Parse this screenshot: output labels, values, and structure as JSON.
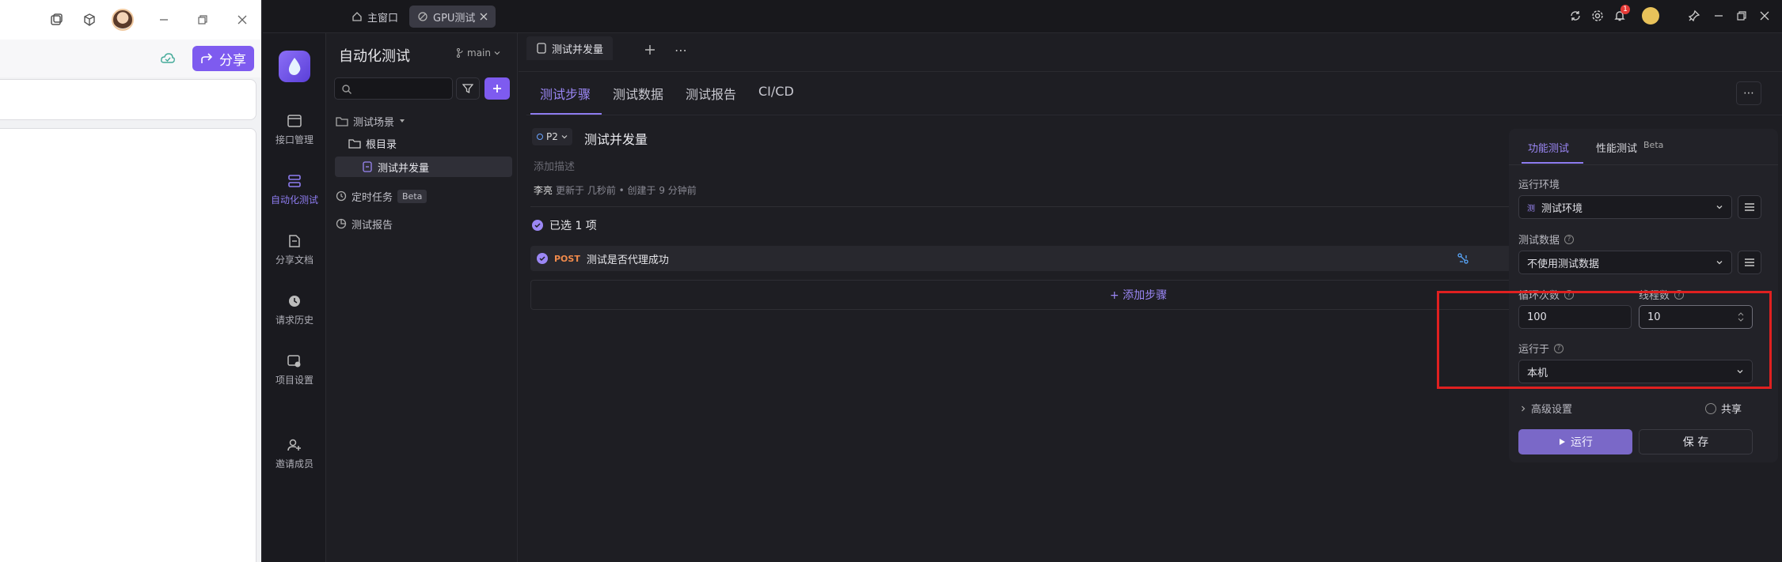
{
  "browser": {
    "share_label": "分享"
  },
  "topbar": {
    "home_tab": "主窗口",
    "active_tab": "GPU测试",
    "notification_count": "1"
  },
  "nav": {
    "items": [
      {
        "label": "接口管理"
      },
      {
        "label": "自动化测试"
      },
      {
        "label": "分享文档"
      },
      {
        "label": "请求历史"
      },
      {
        "label": "项目设置"
      },
      {
        "label": "邀请成员"
      }
    ]
  },
  "tree": {
    "title": "自动化测试",
    "branch": "main",
    "items": {
      "scenes": "测试场景",
      "root": "根目录",
      "current": "测试并发量",
      "scheduled": "定时任务",
      "scheduled_badge": "Beta",
      "reports": "测试报告"
    }
  },
  "doc_tab": {
    "label": "测试并发量"
  },
  "subtabs": [
    "测试步骤",
    "测试数据",
    "测试报告",
    "CI/CD"
  ],
  "scenario": {
    "priority": "P2",
    "name": "测试并发量",
    "desc_placeholder": "添加描述",
    "author": "李亮",
    "meta": "更新于 几秒前 • 创建于 9 分钟前",
    "selected_text": "已选 1 项",
    "step_method": "POST",
    "step_name": "测试是否代理成功",
    "add_step": "+ 添加步骤"
  },
  "run_panel": {
    "tab_func": "功能测试",
    "tab_perf": "性能测试",
    "tab_perf_badge": "Beta",
    "env_label": "运行环境",
    "env_value": "测试环境",
    "env_icon": "测",
    "data_label": "测试数据",
    "data_value": "不使用测试数据",
    "loop_label": "循环次数",
    "loop_value": "100",
    "thread_label": "线程数",
    "thread_value": "10",
    "run_on_label": "运行于",
    "run_on_value": "本机",
    "advanced_label": "高级设置",
    "share_label": "共享",
    "run_button": "运行",
    "save_button": "保 存"
  }
}
